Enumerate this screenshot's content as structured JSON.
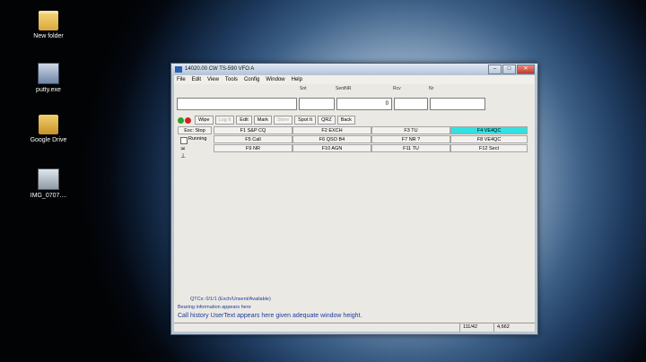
{
  "desktop": {
    "icons": [
      {
        "label": "New folder"
      },
      {
        "label": "putty.exe"
      },
      {
        "label": "Google Drive"
      },
      {
        "label": "IMG_0707...."
      }
    ]
  },
  "window": {
    "title": "14020.00 CW TS-590 VFO A",
    "menu": [
      "File",
      "Edit",
      "View",
      "Tools",
      "Config",
      "Window",
      "Help"
    ],
    "fields": {
      "snt_label": "Snt",
      "sentnr_label": "SentNR",
      "rcv_label": "Rcv",
      "nr_label": "Nr",
      "sentnr_value": "0"
    },
    "toolbar": [
      "Wipe",
      "Log It",
      "Edit",
      "Mark",
      "Store",
      "Spot It",
      "QRZ",
      "Back"
    ],
    "side": {
      "esc": "Esc: Stop",
      "running": "Running"
    },
    "fkeys": [
      [
        "F1 S&P CQ",
        "F2 EXCH",
        "F3 TU",
        "F4 VE4QC"
      ],
      [
        "F5 Call",
        "F6 QSO B4",
        "F7 NR ?",
        "F8 VE4QC"
      ],
      [
        "F9 NR",
        "F10 AGN",
        "F11 TU",
        "F12 Sect"
      ]
    ],
    "qtc": "QTCs: 0/1/1 (Exch/Unsent/Available)",
    "bearing": "Bearing information appears here",
    "callhistory": "Call history UserText appears here given adequate window height.",
    "status": [
      "111/42",
      "4,662"
    ],
    "colors": {
      "highlight": "#35e0e0",
      "accent_text": "#1e3a9c"
    }
  }
}
